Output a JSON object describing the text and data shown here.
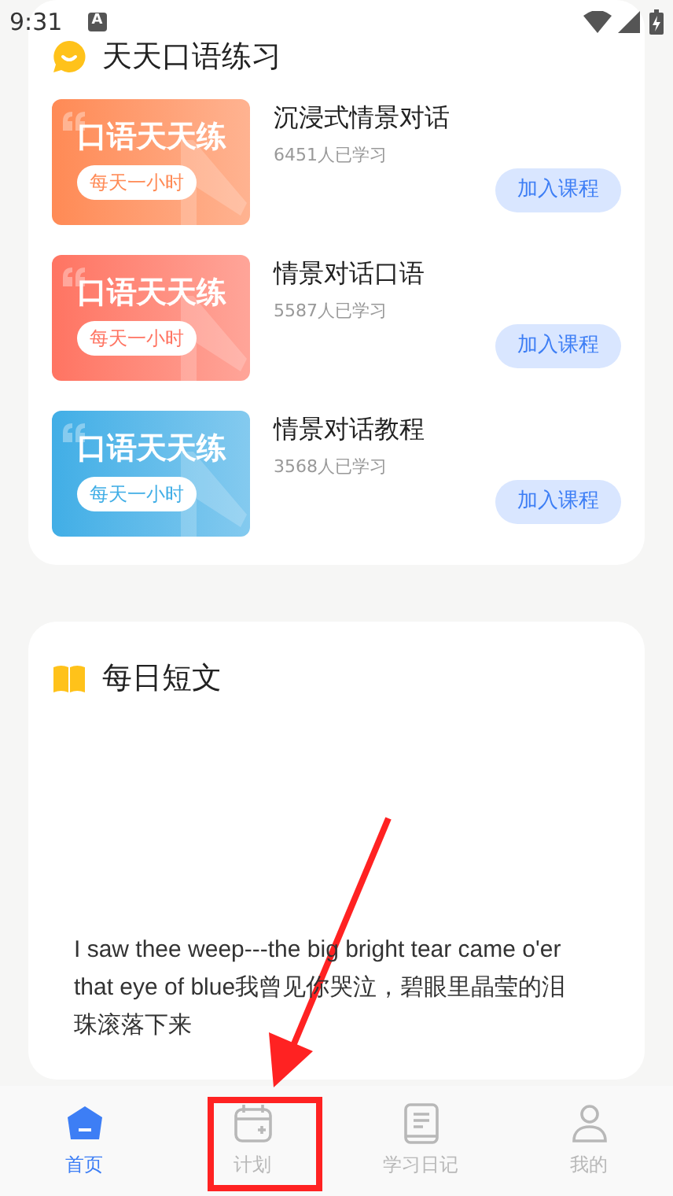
{
  "status_bar": {
    "time": "9:31",
    "notification": "A"
  },
  "section": {
    "title": "天天口语练习"
  },
  "courses": [
    {
      "banner_title": "口语天天练",
      "banner_tag": "每天一小时",
      "color": "#ff8a55",
      "title": "沉浸式情景对话",
      "learners": "6451人已学习",
      "button": "加入课程"
    },
    {
      "banner_title": "口语天天练",
      "banner_tag": "每天一小时",
      "color": "#ff7462",
      "title": "情景对话口语",
      "learners": "5587人已学习",
      "button": "加入课程"
    },
    {
      "banner_title": "口语天天练",
      "banner_tag": "每天一小时",
      "color": "#41aee6",
      "title": "情景对话教程",
      "learners": "3568人已学习",
      "button": "加入课程"
    }
  ],
  "daily": {
    "title": "每日短文",
    "text": "I saw thee weep---the big bright tear came o'er that eye of blue我曾见你哭泣，碧眼里晶莹的泪珠滚落下来"
  },
  "nav": [
    {
      "label": "首页",
      "kind": "home",
      "selected": true
    },
    {
      "label": "计划",
      "kind": "calendar",
      "selected": false
    },
    {
      "label": "学习日记",
      "kind": "diary",
      "selected": false
    },
    {
      "label": "我的",
      "kind": "profile",
      "selected": false
    }
  ]
}
